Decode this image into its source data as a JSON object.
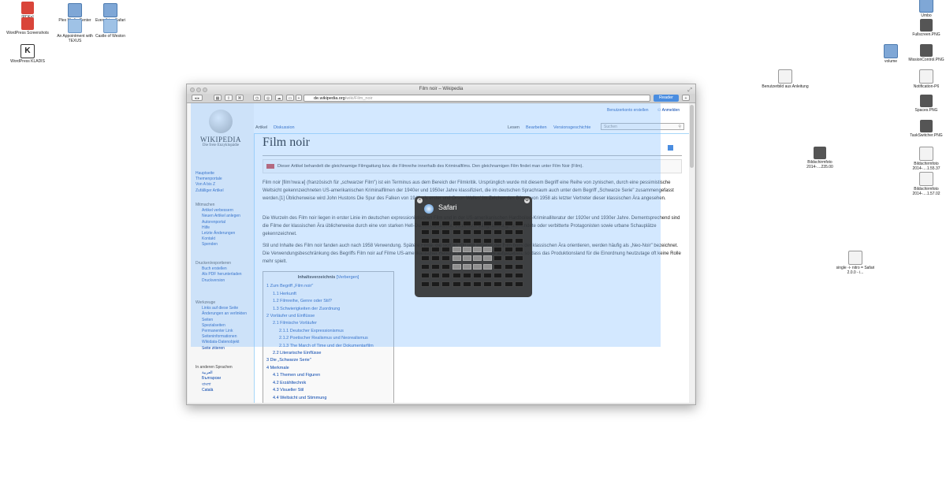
{
  "desktop_icons": [
    {
      "label": "[PDFs]",
      "type": "red"
    },
    {
      "label": "Plex Media Center",
      "type": "blue"
    },
    {
      "label": "Everything Safari",
      "type": "blue"
    },
    {
      "label": "WordPress Screenshots",
      "type": "red"
    },
    {
      "label": "An Appointment with TEXUS",
      "type": "folder"
    },
    {
      "label": "Castle of Weston",
      "type": "folder"
    },
    {
      "label": "WordPress KLADIS",
      "type": "k"
    },
    {
      "label": "Umbo",
      "type": "blue"
    },
    {
      "label": "Fullscreen.PNG",
      "type": "dark"
    },
    {
      "label": "volume",
      "type": "blue"
    },
    {
      "label": "MissionControl.PNG",
      "type": "dark"
    },
    {
      "label": "Benutzerbild aus Anleitung",
      "type": "file"
    },
    {
      "label": "Notification-P6",
      "type": "file"
    },
    {
      "label": "Spaces.PNG",
      "type": "dark"
    },
    {
      "label": "Bildschirmfoto 2014-....235.00",
      "type": "dark"
    },
    {
      "label": "TaskSwitcher.PNG",
      "type": "dark"
    },
    {
      "label": "Bildschirmfoto 2014-....1.55.37",
      "type": "file"
    },
    {
      "label": "Bildschirmfoto 2014-....1.57.02",
      "type": "file"
    },
    {
      "label": "single -i- nitro = Safari 2.0.0 - i...",
      "type": "file"
    }
  ],
  "window": {
    "title": "Film noir – Wikipedia",
    "url_host": "de.wikipedia.org",
    "url_path": "/wiki/Film_noir",
    "reader_label": "Reader"
  },
  "wiki": {
    "logo_title": "WIKIPEDIA",
    "logo_sub": "Die freie Enzyklopädie",
    "nav_main": [
      "Hauptseite",
      "Themenportale",
      "Von A bis Z",
      "Zufälliger Artikel"
    ],
    "mitmachen_head": "Mitmachen",
    "mitmachen": [
      "Artikel verbessern",
      "Neuen Artikel anlegen",
      "Autorenportal",
      "Hilfe",
      "Letzte Änderungen",
      "Kontakt",
      "Spenden"
    ],
    "drucken_head": "Drucken/exportieren",
    "drucken": [
      "Buch erstellen",
      "Als PDF herunterladen",
      "Druckversion"
    ],
    "werkzeuge_head": "Werkzeuge",
    "werkzeuge": [
      "Links auf diese Seite",
      "Änderungen an verlinkten Seiten",
      "Spezialseiten",
      "Permanenter Link",
      "Seiteninformationen",
      "Wikidata-Datenobjekt",
      "Seite zitieren"
    ],
    "sprachen_head": "In anderen Sprachen",
    "sprachen": [
      "العربية",
      "Български",
      "বাংলা",
      "Català"
    ],
    "tab_artikel": "Artikel",
    "tab_diskussion": "Diskussion",
    "tab_lesen": "Lesen",
    "tab_bearbeiten": "Bearbeiten",
    "tab_versionen": "Versionsgeschichte",
    "account_create": "Benutzerkonto erstellen",
    "login": "Anmelden",
    "search_placeholder": "Suchen",
    "heading": "Film noir",
    "notice": "Dieser Artikel behandelt die gleichnamige Filmgattung bzw. die Filmreihe innerhalb des Kriminalfilms. Den gleichnamigen Film findet man unter Film Noir (Film).",
    "p1": "Film noir [film'nwaːʁ] (französisch für „schwarzer Film\") ist ein Terminus aus dem Bereich der Filmkritik. Ursprünglich wurde mit diesem Begriff eine Reihe von zynischen, durch eine pessimistische Weltsicht gekennzeichneten US-amerikanischen Kriminalfilmen der 1940er und 1950er Jahre klassifiziert, die im deutschen Sprachraum auch unter dem Begriff „Schwarze Serie\" zusammengefasst werden.[1] Üblicherweise wird John Hustons Die Spur des Falken von 1941 als erster und Orson Welles' Im Zeichen des Bösen von 1958 als letzter Vertreter dieser klassischen Ära angesehen.",
    "p2": "Die Wurzeln des Film noir liegen in erster Linie im deutschen expressionistischen Film und in der US-amerikanischen Hardboiled-Kriminalliteratur der 1920er und 1930er Jahre. Dementsprechend sind die Filme der klassischen Ära üblicherweise durch eine von starken Hell-Dunkel-Kontrasten dominierte Bildgestaltung, entfremdete oder verbitterte Protagonisten sowie urbane Schauplätze gekennzeichnet.",
    "p3": "Stil und Inhalte des Film noir fanden auch nach 1958 Verwendung. Spätere Filme, die sich an Stil und Inhalten der Film noirs der klassischen Ära orientieren, werden häufig als „Neo-Noir\" bezeichnet. Die Verwendungsbeschränkung des Begriffs Film noir auf Filme US-amerikanischer Herkunft wurde mittlerweile aufgegeben, so dass das Produktionsland für die Einordnung heutzutage oft keine Rolle mehr spielt.",
    "toc_title": "Inhaltsverzeichnis",
    "toc_hide": "[Verbergen]",
    "toc": [
      "1  Zum Begriff „Film noir\"",
      "1.1  Herkunft",
      "1.2  Filmreihe, Genre oder Stil?",
      "1.3  Schwierigkeiten der Zuordnung",
      "2  Vorläufer und Einflüsse",
      "2.1  Filmische Vorläufer",
      "2.1.1  Deutscher Expressionismus",
      "2.1.2  Poetischer Realismus und Neorealismus",
      "2.1.3  The March of Time und der Dokumentarfilm",
      "2.2  Literarische Einflüsse",
      "3  Die „Schwarze Serie\"",
      "4  Merkmale",
      "4.1  Themen und Figuren",
      "4.2  Erzähltechnik",
      "4.3  Visueller Stil",
      "4.4  Weltsicht und Stimmung"
    ]
  },
  "hud": {
    "app_name": "Safari",
    "rows": 8,
    "cols": 10,
    "active_cells": [
      [
        3,
        3
      ],
      [
        3,
        4
      ],
      [
        3,
        5
      ],
      [
        3,
        6
      ],
      [
        4,
        3
      ],
      [
        4,
        4
      ],
      [
        4,
        5
      ],
      [
        4,
        6
      ],
      [
        5,
        3
      ],
      [
        5,
        4
      ],
      [
        5,
        5
      ],
      [
        5,
        6
      ]
    ]
  }
}
